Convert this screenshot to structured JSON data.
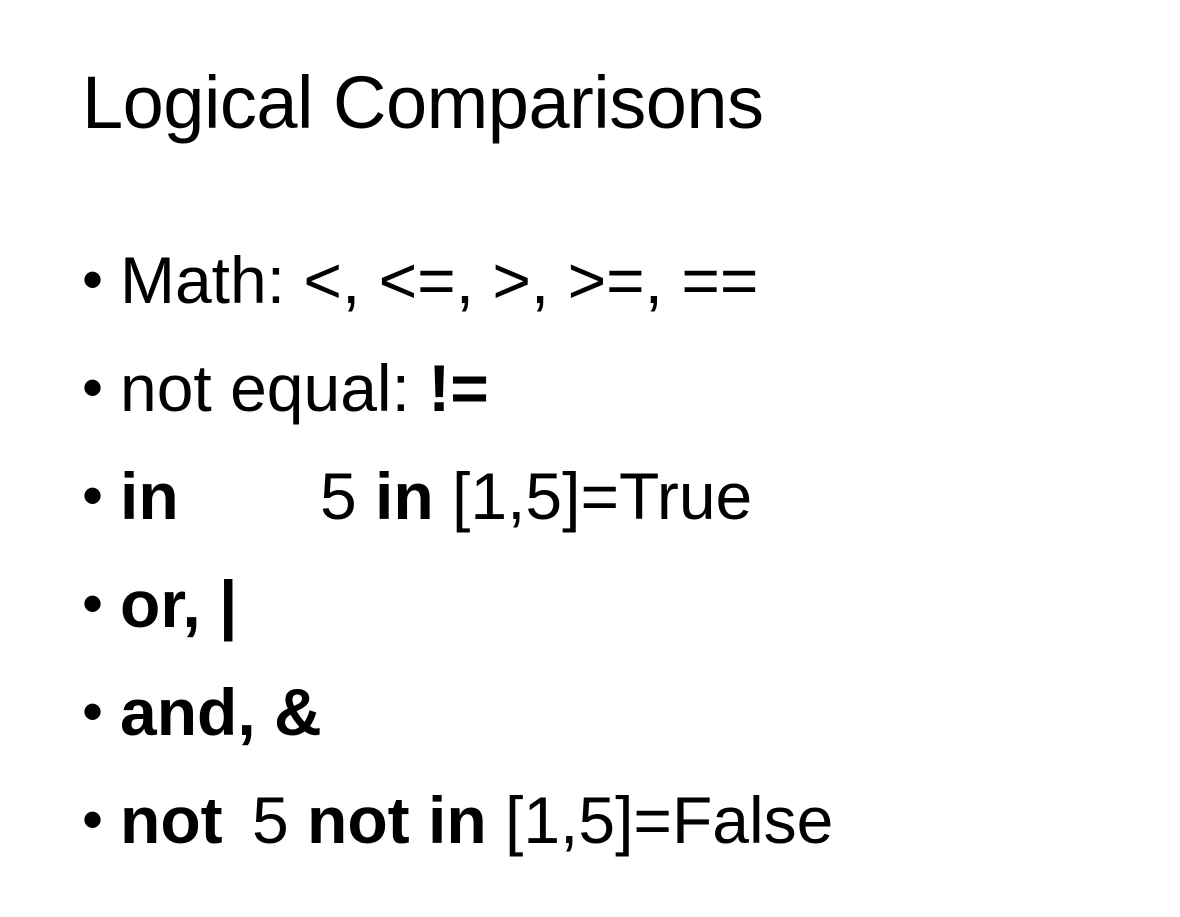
{
  "slide": {
    "title": "Logical Comparisons",
    "bullets": [
      {
        "parts": [
          "Math:  <, <=,  >, >=, =="
        ]
      },
      {
        "parts": [
          "not equal: ",
          "!="
        ]
      },
      {
        "parts": [
          "in",
          "5 ",
          "in",
          " [1,5]=True"
        ]
      },
      {
        "parts": [
          "or,  |"
        ]
      },
      {
        "parts": [
          "and, &"
        ]
      },
      {
        "parts": [
          "not",
          "5 ",
          "not in",
          " [1,5]=False"
        ]
      }
    ],
    "bullet_glyph": "•"
  }
}
